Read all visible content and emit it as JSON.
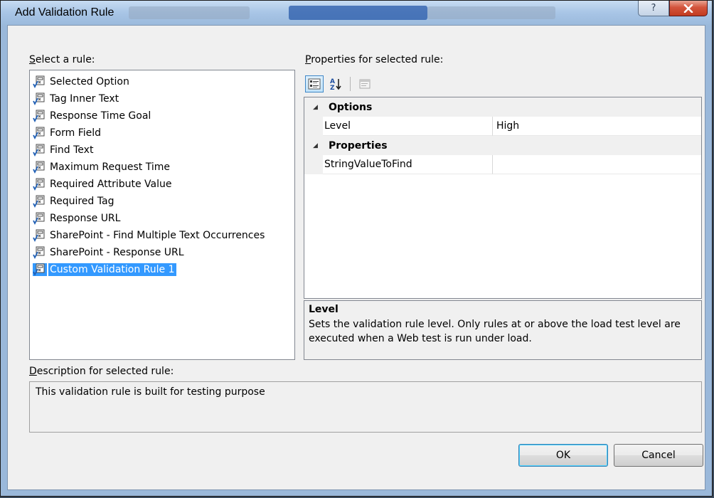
{
  "window": {
    "title": "Add Validation Rule",
    "help_glyph": "?",
    "close_glyph": "x"
  },
  "rules_panel": {
    "label_prefix": "S",
    "label_rest": "elect a rule:",
    "items": [
      {
        "label": "Selected Option",
        "icon": "rule-icon",
        "selected": false
      },
      {
        "label": "Tag Inner Text",
        "icon": "rule-icon",
        "selected": false
      },
      {
        "label": "Response Time Goal",
        "icon": "rule-icon",
        "selected": false
      },
      {
        "label": "Form Field",
        "icon": "rule-icon",
        "selected": false
      },
      {
        "label": "Find Text",
        "icon": "rule-icon",
        "selected": false
      },
      {
        "label": "Maximum Request Time",
        "icon": "rule-icon",
        "selected": false
      },
      {
        "label": "Required Attribute Value",
        "icon": "rule-icon",
        "selected": false
      },
      {
        "label": "Required Tag",
        "icon": "rule-icon",
        "selected": false
      },
      {
        "label": "Response URL",
        "icon": "rule-icon",
        "selected": false
      },
      {
        "label": "SharePoint - Find Multiple Text Occurrences",
        "icon": "rule-icon",
        "selected": false
      },
      {
        "label": "SharePoint - Response URL",
        "icon": "rule-icon",
        "selected": false
      },
      {
        "label": "Custom Validation Rule 1",
        "icon": "rule-icon",
        "selected": true
      }
    ]
  },
  "properties_panel": {
    "label_prefix": "P",
    "label_rest": "roperties for selected rule:",
    "toolbar": {
      "categorized_icon": "categorized-icon",
      "alphabetical_icon": "alphabetical-icon",
      "property_pages_icon": "property-pages-icon"
    },
    "categories": [
      {
        "name": "Options",
        "properties": [
          {
            "name": "Level",
            "value": "High"
          }
        ]
      },
      {
        "name": "Properties",
        "properties": [
          {
            "name": "StringValueToFind",
            "value": ""
          }
        ]
      }
    ],
    "help": {
      "title": "Level",
      "text": "Sets the validation rule level.  Only rules at or above the load test level are executed when a Web test is run under load."
    }
  },
  "description": {
    "label_prefix": "D",
    "label_rest": "escription for selected rule:",
    "text": "This validation rule is built for testing purpose"
  },
  "buttons": {
    "ok": "OK",
    "cancel": "Cancel"
  },
  "colors": {
    "selection": "#3399ff",
    "title_bar": "#a8c5e6",
    "close_button": "#c23b20"
  }
}
